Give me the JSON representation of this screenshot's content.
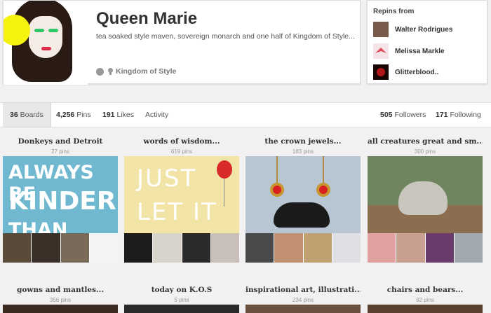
{
  "profile": {
    "name": "Queen Marie",
    "bio": "tea soaked style maven, sovereign monarch and one half of Kingdom of Style...",
    "location": "Kingdom of Style"
  },
  "repins": {
    "heading": "Repins from",
    "users": [
      {
        "name": "Walter Rodrigues",
        "thumb_color": "#7a5a4a"
      },
      {
        "name": "Melissa Markle",
        "thumb_color": "#e24a5a"
      },
      {
        "name": "Glitterblood..",
        "thumb_color": "#3a0a0a"
      }
    ]
  },
  "tabs": {
    "boards": {
      "count": "36",
      "label": "Boards"
    },
    "pins": {
      "count": "4,256",
      "label": "Pins"
    },
    "likes": {
      "count": "191",
      "label": "Likes"
    },
    "activity": {
      "label": "Activity"
    },
    "followers": {
      "count": "505",
      "label": "Followers"
    },
    "following": {
      "count": "171",
      "label": "Following"
    }
  },
  "boards": [
    {
      "title": "Donkeys and Detroit",
      "count": "27 pins",
      "cover_text": [
        "ALWAYS BE",
        "KINDER",
        "THAN YOU"
      ],
      "thumbs": [
        "#5a4a3a",
        "#3a3028",
        "#7a6a5a",
        "#f4f4f4"
      ]
    },
    {
      "title": "words of wisdom...",
      "count": "619 pins",
      "cover_text": [
        "JUST",
        "LET IT"
      ],
      "thumbs": [
        "#1c1c1c",
        "#d8d4cc",
        "#2a2a2a",
        "#c8c0b8"
      ]
    },
    {
      "title": "the crown jewels...",
      "count": "183 pins",
      "thumbs": [
        "#4a4a4a",
        "#c09070",
        "#c0a070",
        "#e0dfe6"
      ]
    },
    {
      "title": "all creatures great and sm...",
      "count": "300 pins",
      "thumbs": [
        "#e0a0a0",
        "#c8a090",
        "#6a3a6a",
        "#a0a8b0"
      ]
    },
    {
      "title": "gowns and mantles...",
      "count": "356 pins"
    },
    {
      "title": "today on K.O.S",
      "count": "5 pins"
    },
    {
      "title": "inspirational art, illustrati...",
      "count": "234 pins"
    },
    {
      "title": "chairs and bears...",
      "count": "92 pins"
    }
  ]
}
